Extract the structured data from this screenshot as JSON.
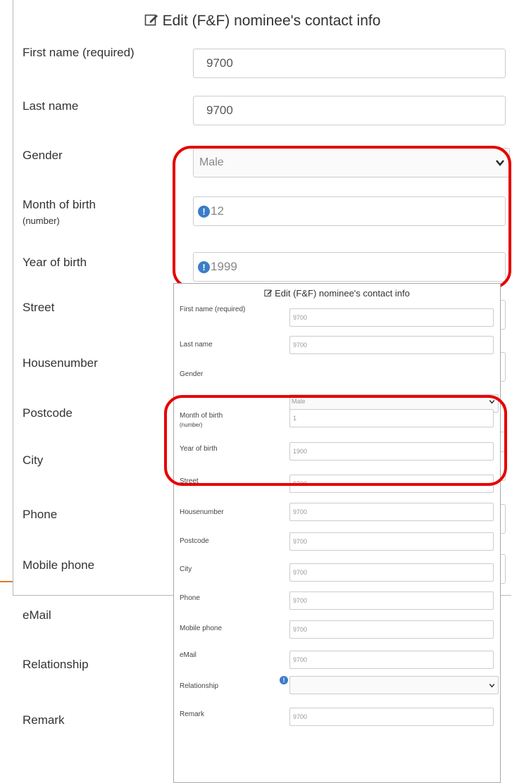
{
  "big_form": {
    "title": "Edit (F&F) nominee's contact info",
    "fields": {
      "first_name_label": "First name (required)",
      "first_name_value": "9700",
      "last_name_label": "Last name",
      "last_name_value": "9700",
      "gender_label": "Gender",
      "gender_value": "Male",
      "month_label": "Month of birth",
      "month_label_sub": "(number)",
      "month_value": "12",
      "year_label": "Year of birth",
      "year_value": "1999",
      "street_label": "Street",
      "housenumber_label": "Housenumber",
      "postcode_label": "Postcode",
      "city_label": "City",
      "phone_label": "Phone",
      "mobile_label": "Mobile phone",
      "email_label": "eMail",
      "relationship_label": "Relationship",
      "remark_label": "Remark"
    },
    "info_glyph": "!"
  },
  "small_form": {
    "title": "Edit (F&F) nominee's contact info",
    "fields": {
      "first_name_label": "First name (required)",
      "first_name_value": "9700",
      "last_name_label": "Last name",
      "last_name_value": "9700",
      "gender_label": "Gender",
      "gender_value": "Male",
      "month_label": "Month of birth",
      "month_label_sub": "(number)",
      "month_value": "1",
      "year_label": "Year of birth",
      "year_value": "1900",
      "street_label": "Street",
      "street_value": "9700",
      "housenumber_label": "Housenumber",
      "housenumber_value": "9700",
      "postcode_label": "Postcode",
      "postcode_value": "9700",
      "city_label": "City",
      "city_value": "9700",
      "phone_label": "Phone",
      "phone_value": "9700",
      "mobile_label": "Mobile phone",
      "mobile_value": "9700",
      "email_label": "eMail",
      "email_value": "9700",
      "relationship_label": "Relationship",
      "relationship_value": "",
      "remark_label": "Remark",
      "remark_value": "9700"
    },
    "info_glyph": "!"
  },
  "icons": {
    "edit": "edit-icon",
    "chevron": "chevron-down-icon",
    "info": "info-icon"
  },
  "colors": {
    "highlight_box": "#e60000",
    "info_icon": "#3b7dc8",
    "orange_line": "#e07a25",
    "text": "#333333",
    "border": "#cccccc"
  }
}
